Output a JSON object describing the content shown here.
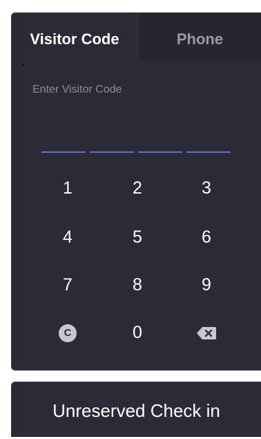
{
  "tabs": {
    "visitor_code": "Visitor Code",
    "phone": "Phone"
  },
  "code_input": {
    "placeholder": "Enter Visitor Code",
    "slot_count": 4
  },
  "keypad": {
    "k1": "1",
    "k2": "2",
    "k3": "3",
    "k4": "4",
    "k5": "5",
    "k6": "6",
    "k7": "7",
    "k8": "8",
    "k9": "9",
    "clear": "C",
    "k0": "0",
    "backspace_icon": "backspace-icon"
  },
  "footer": {
    "checkin_label": "Unreserved Check in"
  },
  "colors": {
    "panel_bg": "#2b2a37",
    "accent": "#6b6bc9",
    "muted_text": "#8e8d99"
  }
}
